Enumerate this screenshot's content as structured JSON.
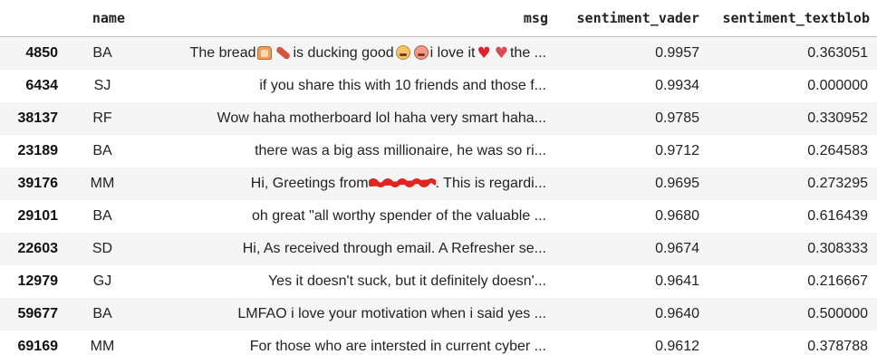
{
  "table": {
    "headers": {
      "index": "",
      "name": "name",
      "msg": "msg",
      "sentiment_vader": "sentiment_vader",
      "sentiment_textblob": "sentiment_textblob"
    },
    "rows": [
      {
        "index": "4850",
        "name": "BA",
        "msg_parts": [
          "The bread",
          "is ducking good",
          "i love it",
          "the ..."
        ],
        "msg_emojis": [
          "bread-icon",
          "sausage-icon",
          "weary-face-icon",
          "pouting-face-icon",
          "red-heart-icon",
          "broken-heart-icon"
        ],
        "sentiment_vader": "0.9957",
        "sentiment_textblob": "0.363051"
      },
      {
        "index": "6434",
        "name": "SJ",
        "msg": "if you share this with 10 friends and those f...",
        "sentiment_vader": "0.9934",
        "sentiment_textblob": "0.000000"
      },
      {
        "index": "38137",
        "name": "RF",
        "msg": "Wow haha motherboard lol haha very smart haha...",
        "sentiment_vader": "0.9785",
        "sentiment_textblob": "0.330952"
      },
      {
        "index": "23189",
        "name": "BA",
        "msg": "there was a big ass millionaire, he was so ri...",
        "sentiment_vader": "0.9712",
        "sentiment_textblob": "0.264583"
      },
      {
        "index": "39176",
        "name": "MM",
        "msg_before": "Hi, Greetings from",
        "msg_after": ". This is regardi...",
        "sentiment_vader": "0.9695",
        "sentiment_textblob": "0.273295"
      },
      {
        "index": "29101",
        "name": "BA",
        "msg": "oh great \"all worthy spender of the valuable ...",
        "sentiment_vader": "0.9680",
        "sentiment_textblob": "0.616439"
      },
      {
        "index": "22603",
        "name": "SD",
        "msg": "Hi, As received through email. A Refresher se...",
        "sentiment_vader": "0.9674",
        "sentiment_textblob": "0.308333"
      },
      {
        "index": "12979",
        "name": "GJ",
        "msg": "Yes it doesn't suck, but it definitely doesn'...",
        "sentiment_vader": "0.9641",
        "sentiment_textblob": "0.216667"
      },
      {
        "index": "59677",
        "name": "BA",
        "msg": "LMFAO i love your motivation when i said yes ...",
        "sentiment_vader": "0.9640",
        "sentiment_textblob": "0.500000"
      },
      {
        "index": "69169",
        "name": "MM",
        "msg": "For those who are intersted in current cyber ...",
        "sentiment_vader": "0.9612",
        "sentiment_textblob": "0.378788"
      }
    ]
  }
}
